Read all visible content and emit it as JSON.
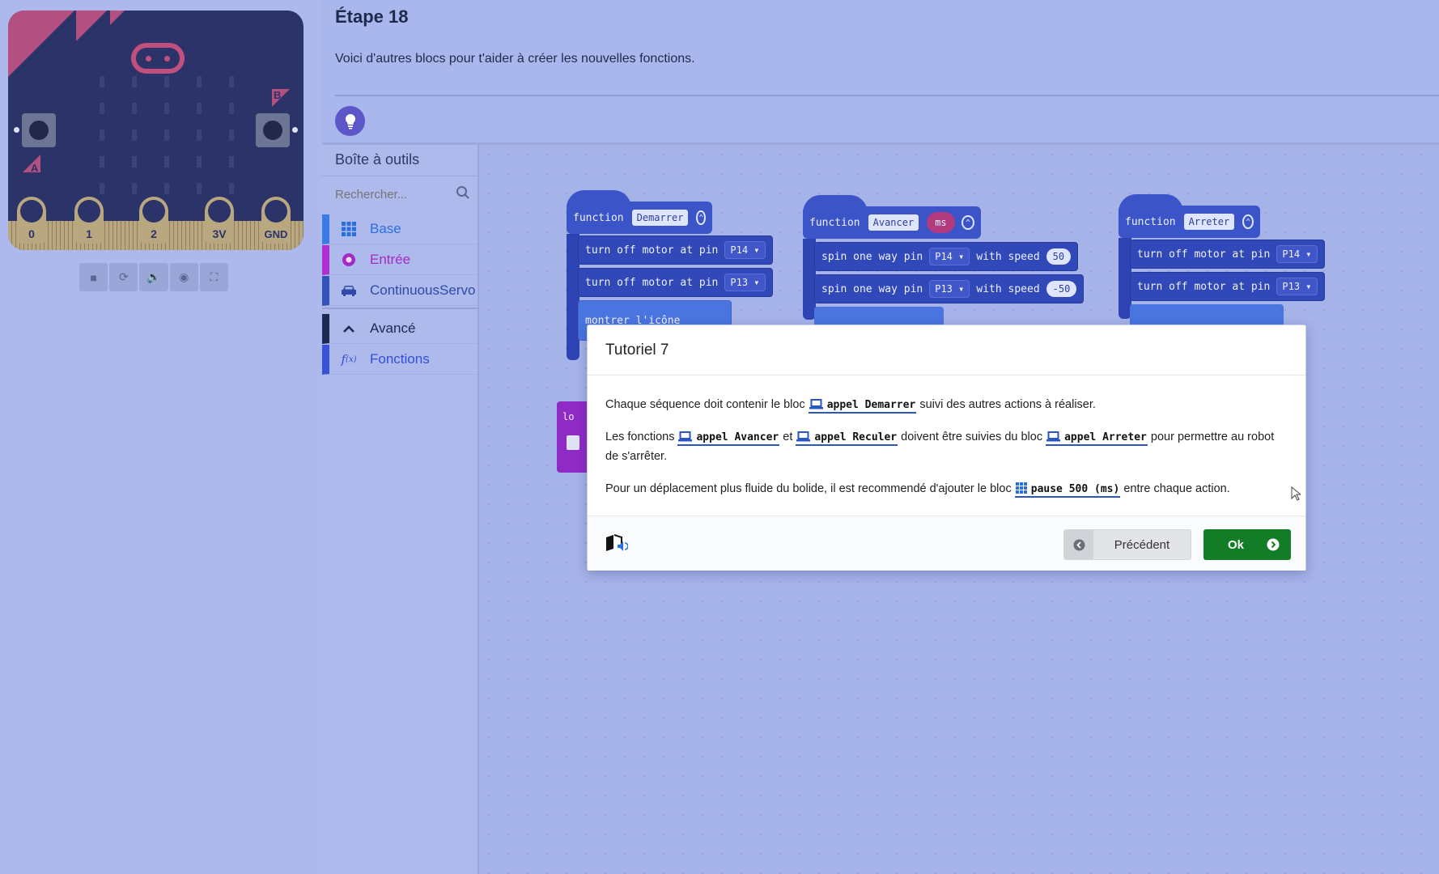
{
  "simulator": {
    "pins": [
      "0",
      "1",
      "2",
      "3V",
      "GND"
    ],
    "button_a": "A",
    "button_b": "B",
    "tools": [
      "stop-icon",
      "restart-icon",
      "mute-icon",
      "screenshot-icon",
      "fullscreen-icon"
    ]
  },
  "tutorial": {
    "step_title": "Étape 18",
    "step_desc": "Voici d'autres blocs pour t'aider à créer les nouvelles fonctions."
  },
  "toolbox": {
    "title": "Boîte à outils",
    "search_placeholder": "Rechercher...",
    "categories": [
      {
        "label": "Base",
        "color": "#3a7be8",
        "icon": "grid-icon"
      },
      {
        "label": "Entrée",
        "color": "#b02fd0",
        "icon": "circle-dot-icon"
      },
      {
        "label": "ContinuousServo",
        "color": "#3452b8",
        "icon": "car-icon"
      }
    ],
    "advanced": {
      "label": "Avancé",
      "color": "#1d2a52",
      "icon": "chevron-up-icon"
    },
    "functions": {
      "label": "Fonctions",
      "color": "#3652d9",
      "icon": "function-icon"
    }
  },
  "workspace": {
    "fn1": {
      "keyword": "function",
      "name": "Demarrer",
      "stmts": [
        {
          "text": "turn off motor at pin",
          "pin": "P14"
        },
        {
          "text": "turn off motor at pin",
          "pin": "P13"
        }
      ],
      "partial": "montrer l'icône"
    },
    "fn2": {
      "keyword": "function",
      "name": "Avancer",
      "param": "ms",
      "stmts": [
        {
          "text": "spin one way pin",
          "pin": "P14",
          "with": "with speed",
          "speed": "50"
        },
        {
          "text": "spin one way pin",
          "pin": "P13",
          "with": "with speed",
          "speed": "-50"
        }
      ]
    },
    "fn3": {
      "keyword": "function",
      "name": "Arreter",
      "stmts": [
        {
          "text": "turn off motor at pin",
          "pin": "P14"
        },
        {
          "text": "turn off motor at pin",
          "pin": "P13"
        }
      ]
    },
    "purple_partial": "lo"
  },
  "dialog": {
    "title": "Tutoriel 7",
    "p1_before": "Chaque séquence doit contenir le bloc",
    "p1_block": "appel Demarrer",
    "p1_after": "suivi des autres actions à réaliser.",
    "p2_before": "Les fonctions",
    "p2_block1": "appel Avancer",
    "p2_mid": "et",
    "p2_block2": "appel Reculer",
    "p2_mid2": "doivent être suivies du bloc",
    "p2_block3": "appel Arreter",
    "p2_after": "pour permettre au robot de s'arrêter.",
    "p3_before": "Pour un déplacement plus fluide du bolide, il est recommendé d'ajouter le bloc",
    "p3_block": "pause 500 (ms)",
    "p3_after": "entre chaque action.",
    "prev_label": "Précédent",
    "ok_label": "Ok"
  }
}
